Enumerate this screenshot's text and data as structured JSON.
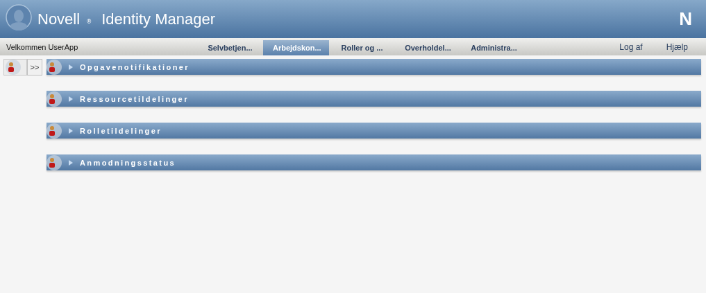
{
  "header": {
    "brand": "Novell",
    "registered": "®",
    "product": "Identity Manager",
    "logo_mark": "N"
  },
  "nav": {
    "welcome": "Velkommen UserApp",
    "tabs": [
      {
        "label": "Selvbetjen...",
        "selected": false
      },
      {
        "label": "Arbejdskon...",
        "selected": true
      },
      {
        "label": "Roller og ...",
        "selected": false
      },
      {
        "label": "Overholdel...",
        "selected": false
      },
      {
        "label": "Administra...",
        "selected": false
      }
    ],
    "links": [
      "Log af",
      "Hjælp"
    ]
  },
  "sidebar": {
    "toggle": ">>"
  },
  "panels": [
    {
      "title": "Opgavenotifikationer",
      "expanded": false
    },
    {
      "title": "Ressourcetildelinger",
      "expanded": false
    },
    {
      "title": "Rolletildelinger",
      "expanded": false
    },
    {
      "title": "Anmodningsstatus",
      "expanded": false
    }
  ]
}
